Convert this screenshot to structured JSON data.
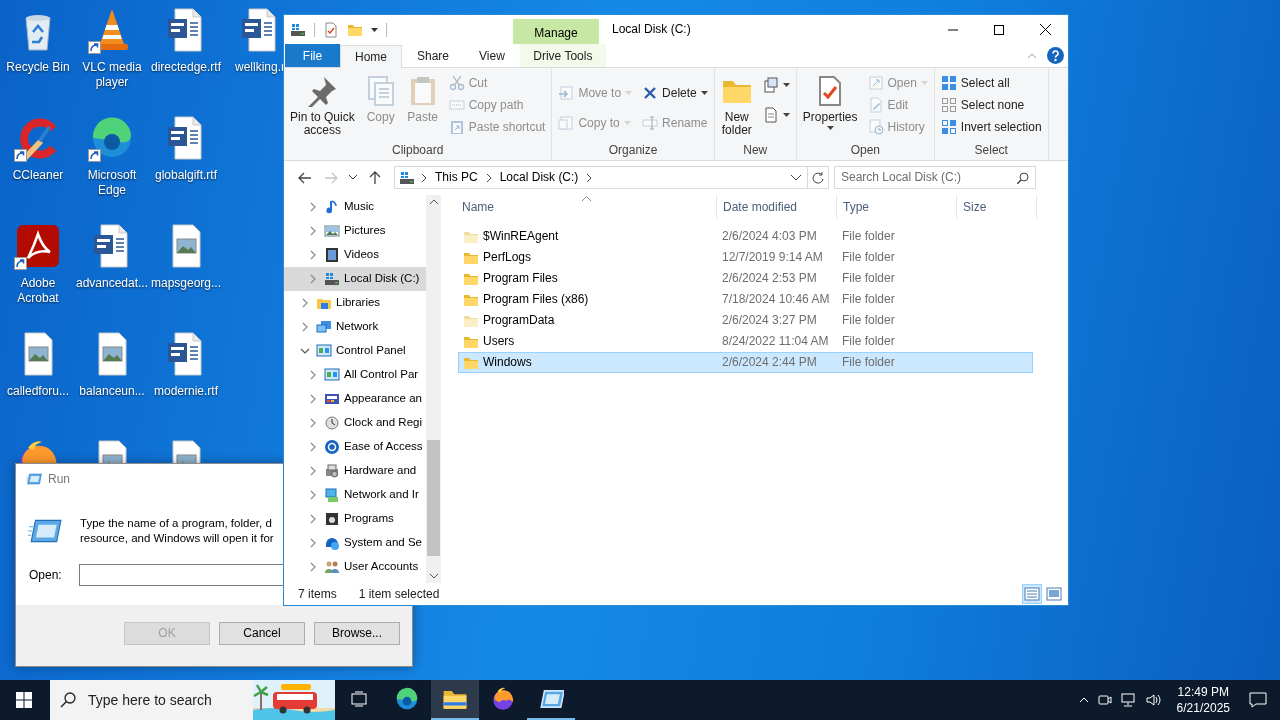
{
  "desktop": {
    "icons": [
      {
        "label": "Recycle Bin",
        "kind": "recycle-bin",
        "shortcut": false
      },
      {
        "label": "CCleaner",
        "kind": "ccleaner",
        "shortcut": true
      },
      {
        "label": "Adobe Acrobat",
        "kind": "acrobat",
        "shortcut": true
      },
      {
        "label": "calledforu...",
        "kind": "image-file",
        "shortcut": false
      },
      {
        "kind": "firefox",
        "shortcut": false
      },
      {
        "label": "VLC media player",
        "kind": "vlc",
        "shortcut": true
      },
      {
        "label": "Microsoft Edge",
        "kind": "edge",
        "shortcut": true
      },
      {
        "label": "advancedat...",
        "kind": "word-file",
        "shortcut": false
      },
      {
        "label": "balanceun...",
        "kind": "image-file",
        "shortcut": false
      },
      {
        "kind": "image-file"
      },
      {
        "label": "directedge.rtf",
        "kind": "word-file",
        "shortcut": false
      },
      {
        "label": "globalgift.rtf",
        "kind": "word-file",
        "shortcut": false
      },
      {
        "label": "mapsgeorg...",
        "kind": "image-file",
        "shortcut": false
      },
      {
        "label": "modernie.rtf",
        "kind": "word-file",
        "shortcut": false
      },
      {
        "kind": "image-file"
      },
      {
        "label": "wellking.r",
        "kind": "word-file",
        "shortcut": false
      }
    ]
  },
  "run_dialog": {
    "title": "Run",
    "message_lines": [
      "Type the name of a program, folder, d",
      "resource, and Windows will open it for"
    ],
    "open_label": "Open:",
    "buttons": [
      {
        "label": "OK",
        "disabled": true
      },
      {
        "label": "Cancel",
        "disabled": false
      },
      {
        "label": "Browse...",
        "disabled": false
      }
    ]
  },
  "explorer": {
    "title": "Local Disk (C:)",
    "context_tab": "Manage",
    "tabs": [
      {
        "label": "File",
        "kind": "file",
        "selected": false
      },
      {
        "label": "Home",
        "kind": "normal",
        "selected": true
      },
      {
        "label": "Share",
        "kind": "normal",
        "selected": false
      },
      {
        "label": "View",
        "kind": "normal",
        "selected": false
      },
      {
        "label": "Drive Tools",
        "kind": "contextual",
        "selected": false
      }
    ],
    "ribbon": [
      {
        "label": "Clipboard",
        "columns": [
          [
            {
              "label": "Pin to Quick\naccess",
              "kind": "pin",
              "disabled": false,
              "dropdown": false
            }
          ],
          [
            {
              "label": "Copy",
              "kind": "copy",
              "disabled": true,
              "dropdown": false
            }
          ],
          [
            {
              "label": "Paste",
              "kind": "paste",
              "disabled": true,
              "dropdown": false
            }
          ],
          [
            {
              "label": "Cut",
              "kind": "cut",
              "disabled": true,
              "dropdown": false
            },
            {
              "label": "Copy path",
              "kind": "copy-path",
              "disabled": true,
              "dropdown": false
            },
            {
              "label": "Paste shortcut",
              "kind": "paste-shortcut",
              "disabled": true,
              "dropdown": false
            }
          ]
        ]
      },
      {
        "label": "Organize",
        "columns": [
          [
            {
              "label": "Move to",
              "kind": "move",
              "disabled": true,
              "dropdown": true
            },
            {
              "label": "Copy to",
              "kind": "copy-to",
              "disabled": true,
              "dropdown": true
            }
          ],
          [
            {
              "label": "Delete",
              "kind": "delete",
              "disabled": false,
              "dropdown": true
            },
            {
              "label": "Rename",
              "kind": "rename",
              "disabled": true,
              "dropdown": false
            }
          ]
        ]
      },
      {
        "label": "New",
        "columns": [
          [
            {
              "label": "New\nfolder",
              "kind": "new-folder",
              "disabled": false,
              "dropdown": false
            }
          ],
          [
            {
              "kind": "new-item",
              "disabled": false,
              "dropdown": true
            },
            {
              "kind": "easy-access",
              "disabled": false,
              "dropdown": true
            }
          ]
        ]
      },
      {
        "label": "Open",
        "columns": [
          [
            {
              "label": "Properties",
              "kind": "properties",
              "disabled": false,
              "dropdown": true
            }
          ],
          [
            {
              "label": "Open",
              "kind": "open",
              "disabled": true,
              "dropdown": true
            },
            {
              "label": "Edit",
              "kind": "edit",
              "disabled": true,
              "dropdown": false
            },
            {
              "label": "History",
              "kind": "history",
              "disabled": true,
              "dropdown": false
            }
          ]
        ]
      },
      {
        "label": "Select",
        "columns": [
          [
            {
              "label": "Select all",
              "kind": "select-all",
              "disabled": false,
              "dropdown": false
            },
            {
              "label": "Select none",
              "kind": "select-none",
              "disabled": false,
              "dropdown": false
            },
            {
              "label": "Invert selection",
              "kind": "invert",
              "disabled": false,
              "dropdown": false
            }
          ]
        ]
      }
    ],
    "history": {
      "back_enabled": true,
      "forward_enabled": false
    },
    "address": {
      "crumbs": [
        "This PC",
        "Local Disk (C:)"
      ]
    },
    "search": {
      "placeholder": "Search Local Disk (C:)"
    },
    "nav_tree": [
      {
        "children": [
          {
            "label": "Music",
            "kind": "music",
            "expanded": false,
            "selected": false
          },
          {
            "label": "Pictures",
            "kind": "pictures",
            "expanded": false,
            "selected": false
          },
          {
            "label": "Videos",
            "kind": "videos",
            "expanded": false,
            "selected": false
          },
          {
            "label": "Local Disk (C:)",
            "kind": "drive",
            "expanded": false,
            "selected": true
          }
        ]
      },
      {
        "label": "Libraries",
        "kind": "libraries",
        "expanded": false,
        "selected": false
      },
      {
        "label": "Network",
        "kind": "network",
        "expanded": false,
        "selected": false
      },
      {
        "label": "Control Panel",
        "kind": "control-panel",
        "expanded": true,
        "selected": false,
        "children": [
          {
            "label": "All Control Par",
            "kind": "control-panel",
            "expanded": false,
            "selected": false
          },
          {
            "label": "Appearance an",
            "kind": "appearance",
            "expanded": false,
            "selected": false
          },
          {
            "label": "Clock and Regi",
            "kind": "clock",
            "expanded": false,
            "selected": false
          },
          {
            "label": "Ease of Access",
            "kind": "ease",
            "expanded": false,
            "selected": false
          },
          {
            "label": "Hardware and",
            "kind": "hardware",
            "expanded": false,
            "selected": false
          },
          {
            "label": "Network and Ir",
            "kind": "network-internet",
            "expanded": false,
            "selected": false
          },
          {
            "label": "Programs",
            "kind": "programs",
            "expanded": false,
            "selected": false
          },
          {
            "label": "System and Se",
            "kind": "security",
            "expanded": false,
            "selected": false
          },
          {
            "label": "User Accounts",
            "kind": "users",
            "expanded": false,
            "selected": false
          }
        ]
      }
    ],
    "columns": [
      {
        "label": "Name",
        "sorted": true
      },
      {
        "label": "Date modified",
        "sorted": false
      },
      {
        "label": "Type",
        "sorted": false
      },
      {
        "label": "Size",
        "sorted": false
      }
    ],
    "files": [
      {
        "name": "$WinREAgent",
        "date": "2/6/2024 4:03 PM",
        "type": "File folder",
        "hidden": true,
        "selected": false
      },
      {
        "name": "PerfLogs",
        "date": "12/7/2019 9:14 AM",
        "type": "File folder",
        "hidden": false,
        "selected": false
      },
      {
        "name": "Program Files",
        "date": "2/6/2024 2:53 PM",
        "type": "File folder",
        "hidden": false,
        "selected": false
      },
      {
        "name": "Program Files (x86)",
        "date": "7/18/2024 10:46 AM",
        "type": "File folder",
        "hidden": false,
        "selected": false
      },
      {
        "name": "ProgramData",
        "date": "2/6/2024 3:27 PM",
        "type": "File folder",
        "hidden": true,
        "selected": false
      },
      {
        "name": "Users",
        "date": "8/24/2022 11:04 AM",
        "type": "File folder",
        "hidden": false,
        "selected": false
      },
      {
        "name": "Windows",
        "date": "2/6/2024 2:44 PM",
        "type": "File folder",
        "hidden": false,
        "selected": true
      }
    ],
    "status": {
      "count": "7 items",
      "selection": "1 item selected"
    },
    "view_modes": [
      {
        "kind": "details",
        "selected": true
      },
      {
        "kind": "large-icons",
        "selected": false
      }
    ]
  },
  "taskbar": {
    "search_placeholder": "Type here to search",
    "apps": [
      {
        "kind": "task-view",
        "open": false,
        "selected": false
      },
      {
        "kind": "edge",
        "open": false,
        "selected": false
      },
      {
        "kind": "explorer",
        "open": true,
        "selected": true
      },
      {
        "kind": "firefox",
        "open": false,
        "selected": false
      },
      {
        "kind": "run",
        "open": true,
        "selected": false
      }
    ],
    "time": "12:49 PM",
    "date": "6/21/2025"
  }
}
